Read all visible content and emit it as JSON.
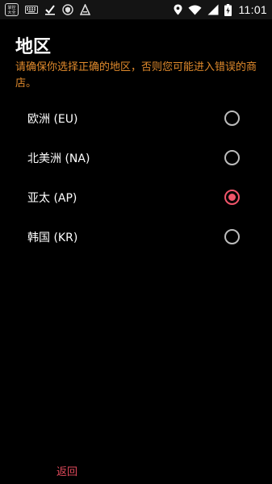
{
  "status_bar": {
    "app_badge_lines": [
      "掌控",
      "大全"
    ],
    "time": "11:01",
    "icons": [
      "app-badge-icon",
      "keyboard-icon",
      "checkmark-icon",
      "shield-icon",
      "android-a-icon",
      "location-icon",
      "wifi-icon",
      "signal-icon",
      "battery-charging-icon"
    ]
  },
  "page": {
    "title": "地区",
    "warning": "请确保你选择正确的地区，否则您可能进入错误的商店。"
  },
  "regions": [
    {
      "label": "欧洲 (EU)",
      "selected": false
    },
    {
      "label": "北美洲 (NA)",
      "selected": false
    },
    {
      "label": "亚太 (AP)",
      "selected": true
    },
    {
      "label": "韩国 (KR)",
      "selected": false
    }
  ],
  "footer": {
    "back_label": "返回"
  },
  "colors": {
    "accent": "#f0556a",
    "warning_text": "#e08a2c",
    "back_text": "#e24a5c",
    "background": "#000000"
  }
}
